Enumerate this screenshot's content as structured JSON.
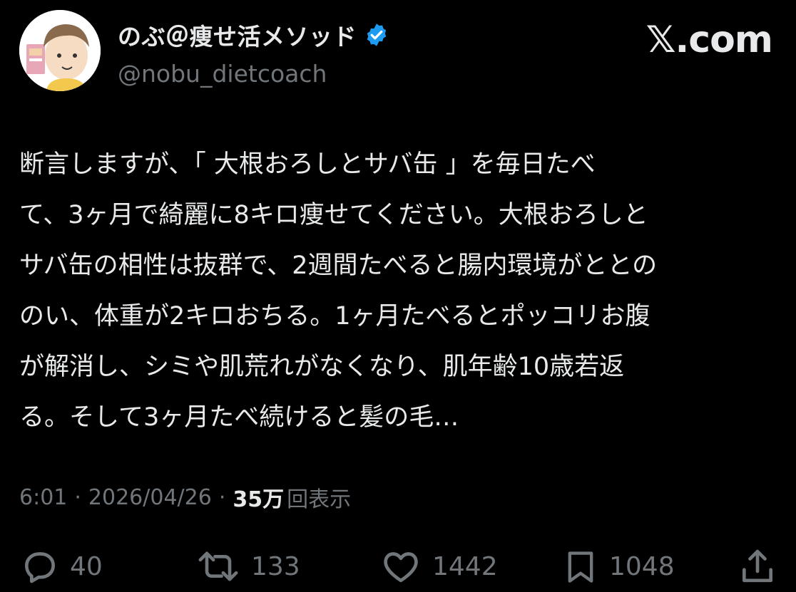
{
  "header": {
    "display_name": "のぶ＠痩せ活メソッド",
    "handle": "@nobu_dietcoach",
    "brand": "𝕏.com"
  },
  "tweet": {
    "lines": [
      "断言しますが、「 大根おろしとサバ缶 」を毎日たべ",
      "て、3ヶ月で綺麗に8キロ痩せてください。大根おろしと",
      "サバ缶の相性は抜群で、2週間たべると腸内環境がととの",
      "のい、体重が2キロおちる。1ヶ月たべるとポッコリお腹",
      "が解消し、シミや肌荒れがなくなり、肌年齢10歳若返",
      "る。そして3ヶ月たべ続けると髪の毛…"
    ]
  },
  "meta": {
    "time": "6:01",
    "separator": "·",
    "date": "2026/04/26",
    "views_count": "35万",
    "views_label": "回表示"
  },
  "actions": {
    "replies": "40",
    "reposts": "133",
    "likes": "1442",
    "bookmarks": "1048"
  },
  "colors": {
    "background": "#000000",
    "text": "#e7e9ea",
    "muted": "#71767b",
    "verified": "#1d9bf0"
  },
  "icons": {
    "verified": "verified-badge-icon",
    "reply": "speech-bubble-icon",
    "repost": "repost-arrows-icon",
    "like": "heart-icon",
    "bookmark": "bookmark-icon",
    "share": "share-upload-icon"
  }
}
